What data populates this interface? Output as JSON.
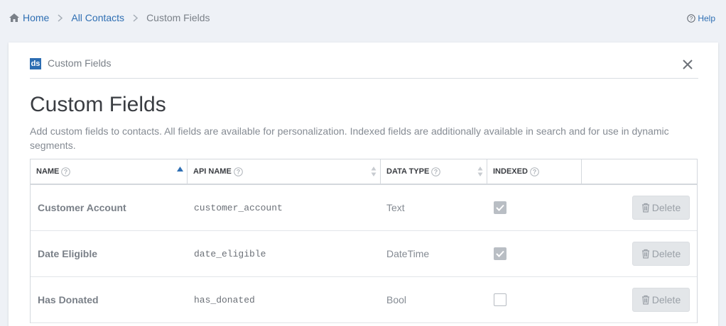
{
  "breadcrumb": {
    "home": "Home",
    "contacts": "All Contacts",
    "current": "Custom Fields"
  },
  "help": "Help",
  "header": {
    "logo": "ds",
    "app_name": "Custom Fields"
  },
  "page": {
    "title": "Custom Fields",
    "description": "Add custom fields to contacts. All fields are available for personalization. Indexed fields are additionally available in search and for use in dynamic segments."
  },
  "table": {
    "columns": {
      "name": "NAME",
      "api_name": "API NAME",
      "data_type": "DATA TYPE",
      "indexed": "INDEXED"
    },
    "rows": [
      {
        "name": "Customer Account",
        "api_name": "customer_account",
        "data_type": "Text",
        "indexed": true,
        "delete": "Delete"
      },
      {
        "name": "Date Eligible",
        "api_name": "date_eligible",
        "data_type": "DateTime",
        "indexed": true,
        "delete": "Delete"
      },
      {
        "name": "Has Donated",
        "api_name": "has_donated",
        "data_type": "Bool",
        "indexed": false,
        "delete": "Delete"
      }
    ]
  },
  "colors": {
    "link": "#2f6fb3",
    "logo": "#2c6db2",
    "background": "#eef1f6"
  }
}
